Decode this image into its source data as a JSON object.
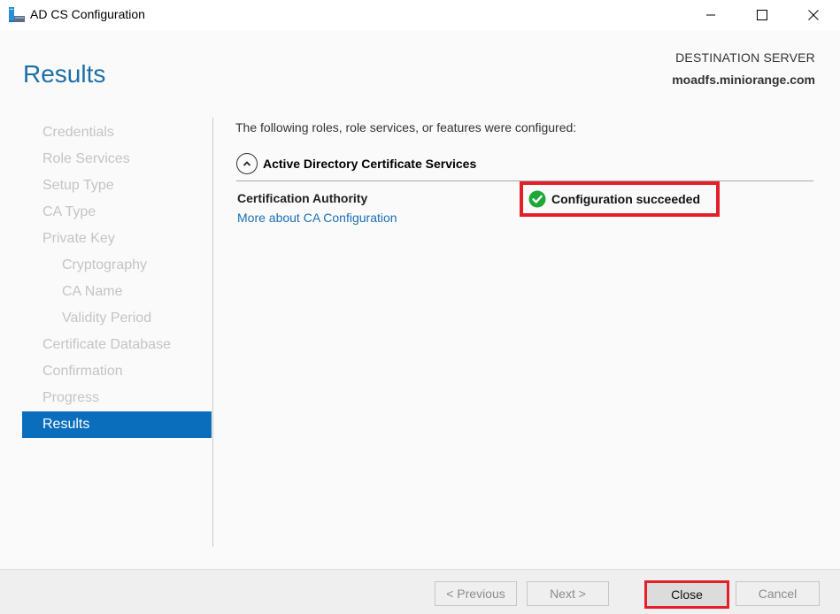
{
  "window": {
    "title": "AD CS Configuration",
    "controls": {
      "minimize": "minimize",
      "maximize": "maximize",
      "close": "close"
    }
  },
  "header": {
    "page_title": "Results",
    "destination_label": "DESTINATION SERVER",
    "destination_server": "moadfs.miniorange.com"
  },
  "sidebar": {
    "items": [
      {
        "label": "Credentials",
        "level": 0,
        "active": false
      },
      {
        "label": "Role Services",
        "level": 0,
        "active": false
      },
      {
        "label": "Setup Type",
        "level": 0,
        "active": false
      },
      {
        "label": "CA Type",
        "level": 0,
        "active": false
      },
      {
        "label": "Private Key",
        "level": 0,
        "active": false
      },
      {
        "label": "Cryptography",
        "level": 1,
        "active": false
      },
      {
        "label": "CA Name",
        "level": 1,
        "active": false
      },
      {
        "label": "Validity Period",
        "level": 1,
        "active": false
      },
      {
        "label": "Certificate Database",
        "level": 0,
        "active": false
      },
      {
        "label": "Confirmation",
        "level": 0,
        "active": false
      },
      {
        "label": "Progress",
        "level": 0,
        "active": false
      },
      {
        "label": "Results",
        "level": 0,
        "active": true
      }
    ]
  },
  "main": {
    "intro": "The following roles, role services, or features were configured:",
    "section": {
      "title": "Active Directory Certificate Services",
      "expanded": true,
      "role_name": "Certification Authority",
      "link": "More about CA Configuration",
      "status": "Configuration succeeded",
      "status_icon": "success-check-icon",
      "status_color": "#1fa83a"
    }
  },
  "footer": {
    "previous": "< Previous",
    "next": "Next >",
    "close": "Close",
    "cancel": "Cancel"
  },
  "colors": {
    "accent": "#0a6ebd",
    "title": "#1e6fa8",
    "highlight": "#e3202a",
    "link": "#1a6fb5"
  }
}
